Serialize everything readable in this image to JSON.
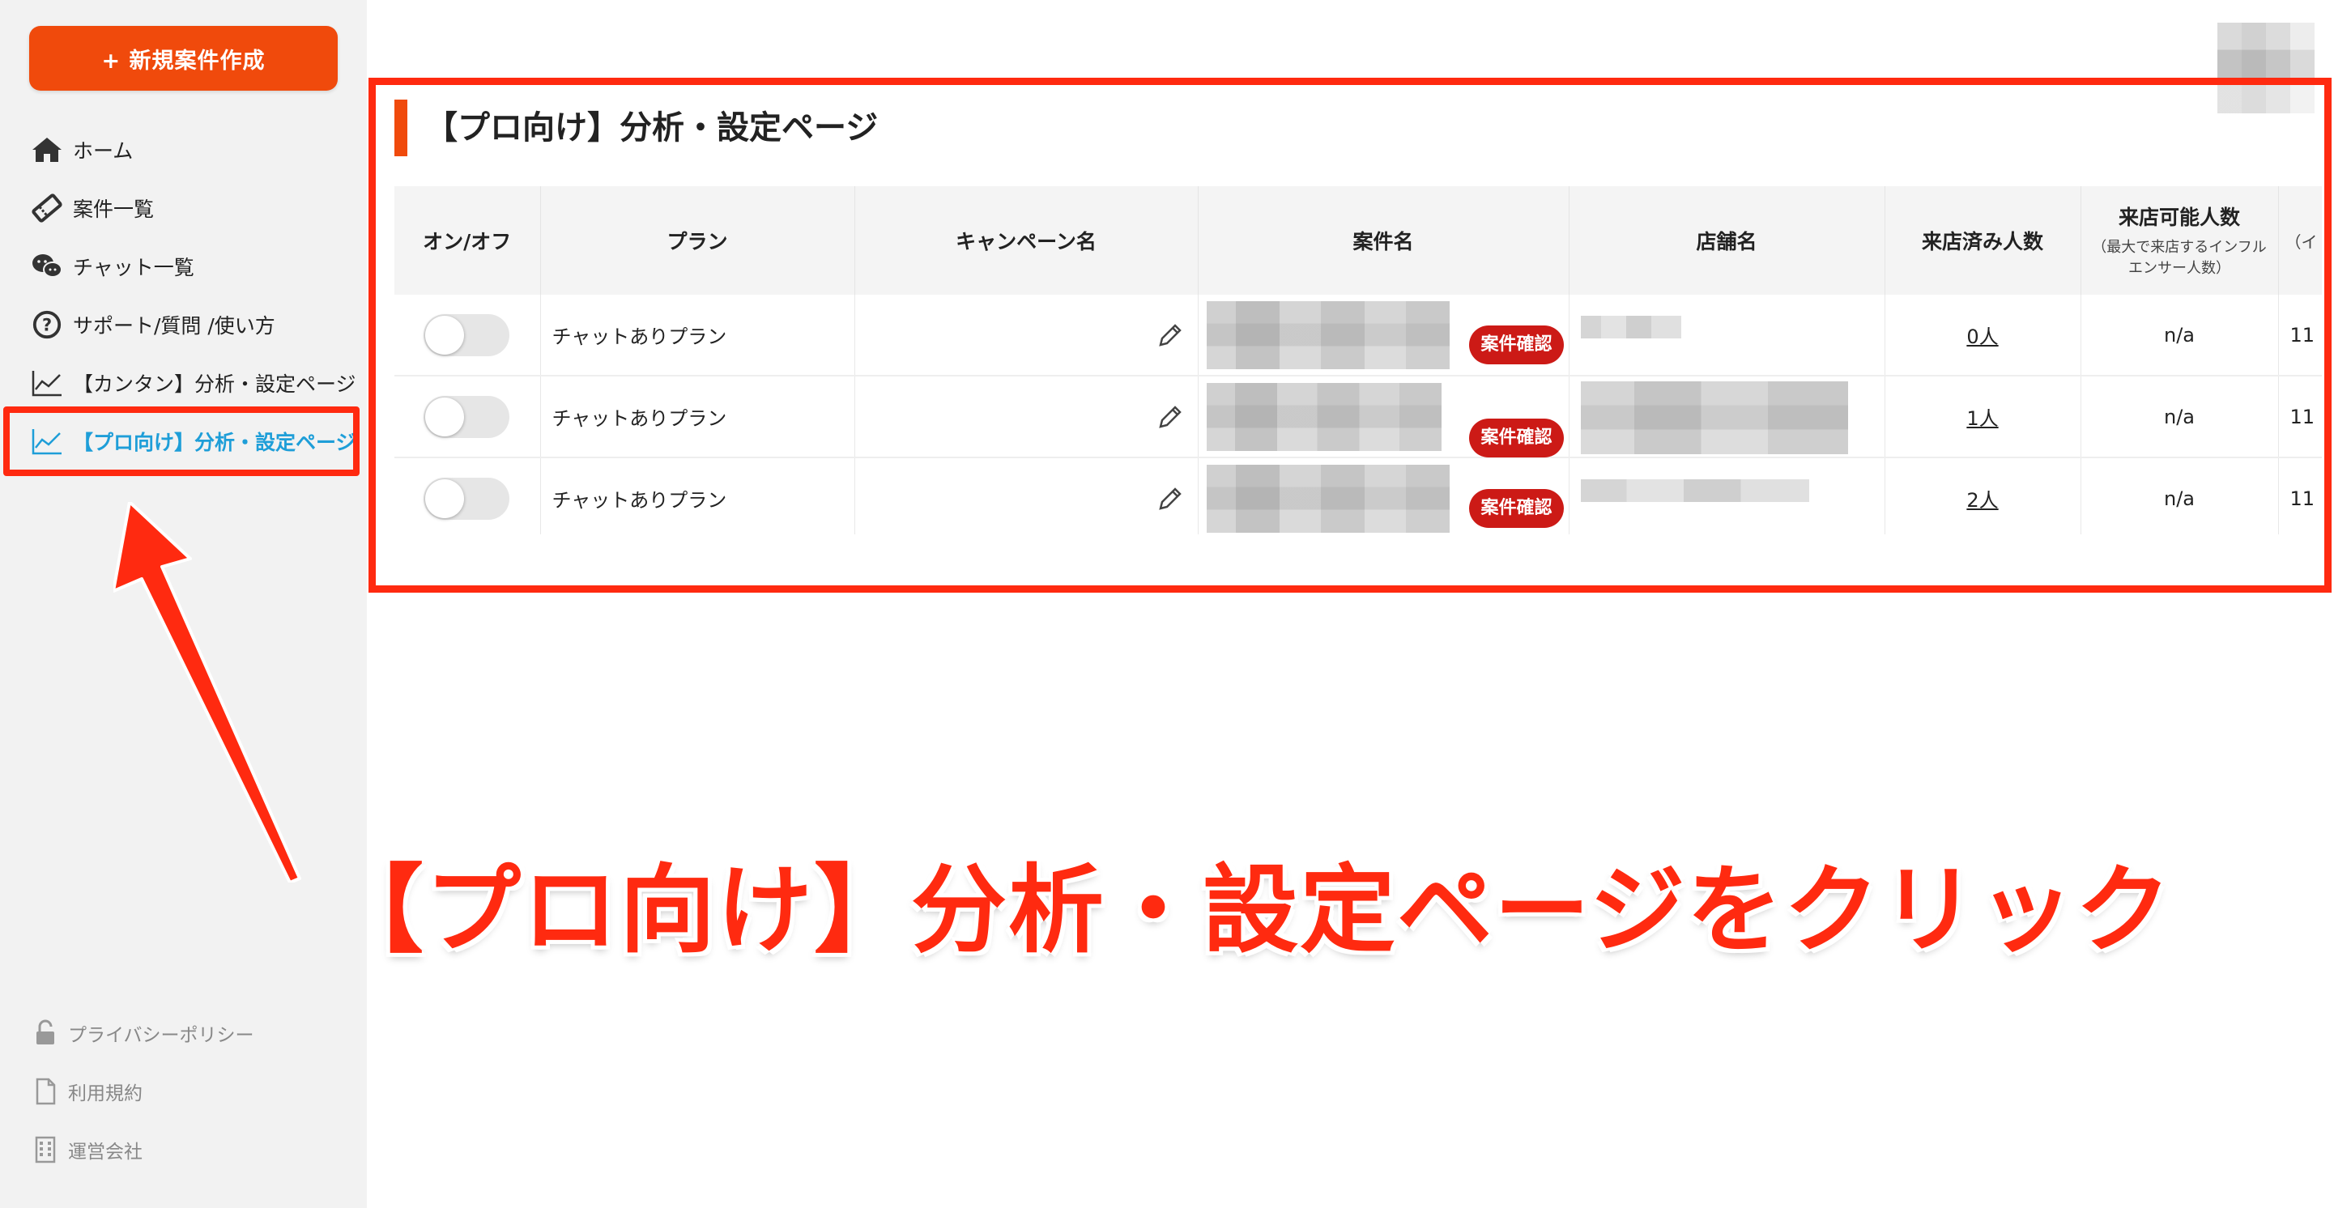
{
  "sidebar": {
    "new_button": "+ 新規案件作成",
    "items": [
      {
        "label": "ホーム",
        "icon": "home-icon"
      },
      {
        "label": "案件一覧",
        "icon": "ticket-icon"
      },
      {
        "label": "チャット一覧",
        "icon": "chat-icon"
      },
      {
        "label": "サポート/質問 /使い方",
        "icon": "question-icon"
      },
      {
        "label": "【カンタン】分析・設定ページ",
        "icon": "chart-icon"
      },
      {
        "label": "【プロ向け】分析・設定ページ",
        "icon": "chart-icon"
      }
    ],
    "active_color": "#1e9ed8",
    "footer": [
      {
        "label": "プライバシーポリシー",
        "icon": "lock-icon"
      },
      {
        "label": "利用規約",
        "icon": "document-icon"
      },
      {
        "label": "運営会社",
        "icon": "building-icon"
      }
    ]
  },
  "main": {
    "title": "【プロ向け】分析・設定ページ",
    "table": {
      "headers": [
        "オン/オフ",
        "プラン",
        "キャンペーン名",
        "案件名",
        "店舗名",
        "来店済み人数",
        "来店可能人数"
      ],
      "header_sub": "（最大で来店するインフルエンサー人数）",
      "partial_header": "（イ",
      "confirm_label": "案件確認",
      "rows": [
        {
          "plan": "チャットありプラン",
          "visited": "0人",
          "capacity": "n/a",
          "extra": "11"
        },
        {
          "plan": "チャットありプラン",
          "visited": "1人",
          "capacity": "n/a",
          "extra": "11"
        },
        {
          "plan": "チャットありプラン",
          "visited": "2人",
          "capacity": "n/a",
          "extra": "11"
        }
      ]
    }
  },
  "annotation": {
    "text": "【プロ向け】分析・設定ページをクリック",
    "color": "#ff2a10"
  },
  "colors": {
    "brand_orange": "#f04a0c",
    "confirm_red": "#cc1a16"
  }
}
